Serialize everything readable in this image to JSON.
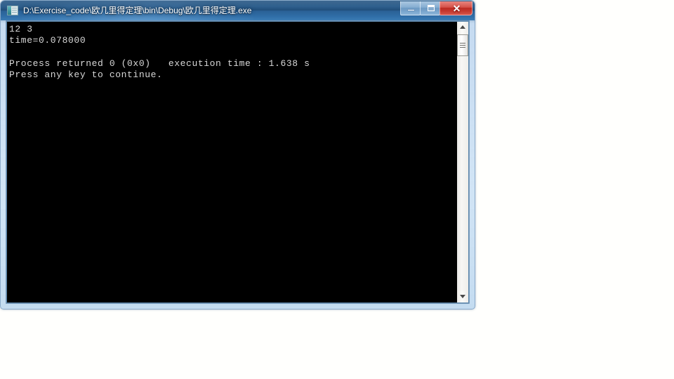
{
  "desktop": {
    "background_color": "#fffffd"
  },
  "window": {
    "title": "D:\\Exercise_code\\欧几里得定理\\bin\\Debug\\欧几里得定理.exe",
    "icon": "console-app-icon",
    "titlebar_color": "#1e4f7e",
    "frame_color": "#b9d7ef",
    "controls": {
      "minimize_label": "",
      "maximize_label": "",
      "close_label": "✕",
      "close_color": "#c2241a"
    }
  },
  "console": {
    "background_color": "#000000",
    "foreground_color": "#d8d8d8",
    "lines": [
      "12 3",
      "time=0.078000",
      "",
      "Process returned 0 (0x0)   execution time : 1.638 s",
      "Press any key to continue."
    ],
    "text": "12 3\ntime=0.078000\n\nProcess returned 0 (0x0)   execution time : 1.638 s\nPress any key to continue.",
    "scrollbar": {
      "up_arrow": "▲",
      "down_arrow": "▼",
      "thumb_position_percent": 0
    }
  }
}
